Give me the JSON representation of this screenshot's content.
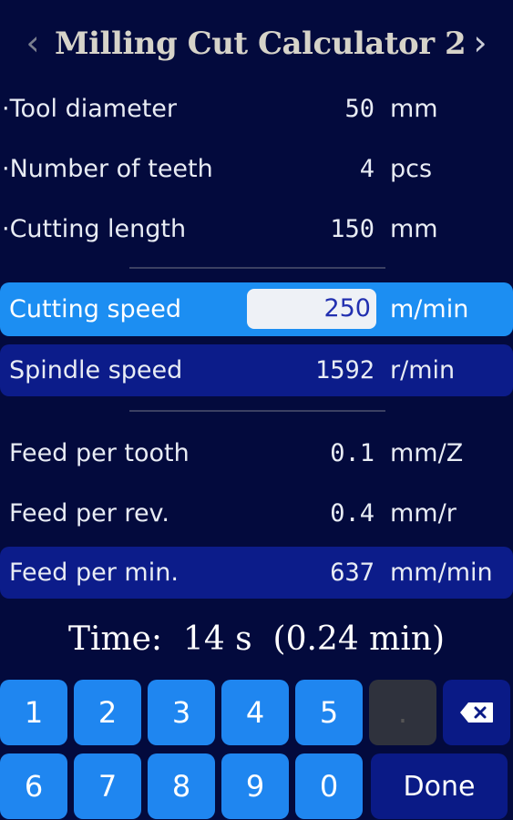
{
  "header": {
    "title": "Milling Cut Calculator 2",
    "prev_icon": "chevron-left-icon",
    "next_icon": "chevron-right-icon",
    "prev_glyph": "‹",
    "next_glyph": "›"
  },
  "rows": [
    {
      "label": "·Tool diameter",
      "value": "50",
      "unit": "mm"
    },
    {
      "label": "·Number of teeth",
      "value": "4",
      "unit": "pcs"
    },
    {
      "label": "·Cutting length",
      "value": "150",
      "unit": "mm"
    },
    {
      "label": "Cutting speed",
      "value": "250",
      "unit": "m/min"
    },
    {
      "label": "Spindle speed",
      "value": "1592",
      "unit": "r/min"
    },
    {
      "label": "Feed per tooth",
      "value": "0.1",
      "unit": "mm/Z"
    },
    {
      "label": "Feed per rev.",
      "value": "0.4",
      "unit": "mm/r"
    },
    {
      "label": "Feed per min.",
      "value": "637",
      "unit": "mm/min"
    }
  ],
  "time": {
    "text": "Time:  14 s  (0.24 min)"
  },
  "keypad": {
    "keys": [
      "1",
      "2",
      "3",
      "4",
      "5",
      "6",
      "7",
      "8",
      "9",
      "0"
    ],
    "dot_key": ".",
    "done_label": "Done",
    "backspace_icon": "backspace-icon"
  },
  "colors": {
    "background": "#030a3d",
    "accent_blue": "#1f86f0",
    "highlight_navy": "#0c1c8a"
  }
}
